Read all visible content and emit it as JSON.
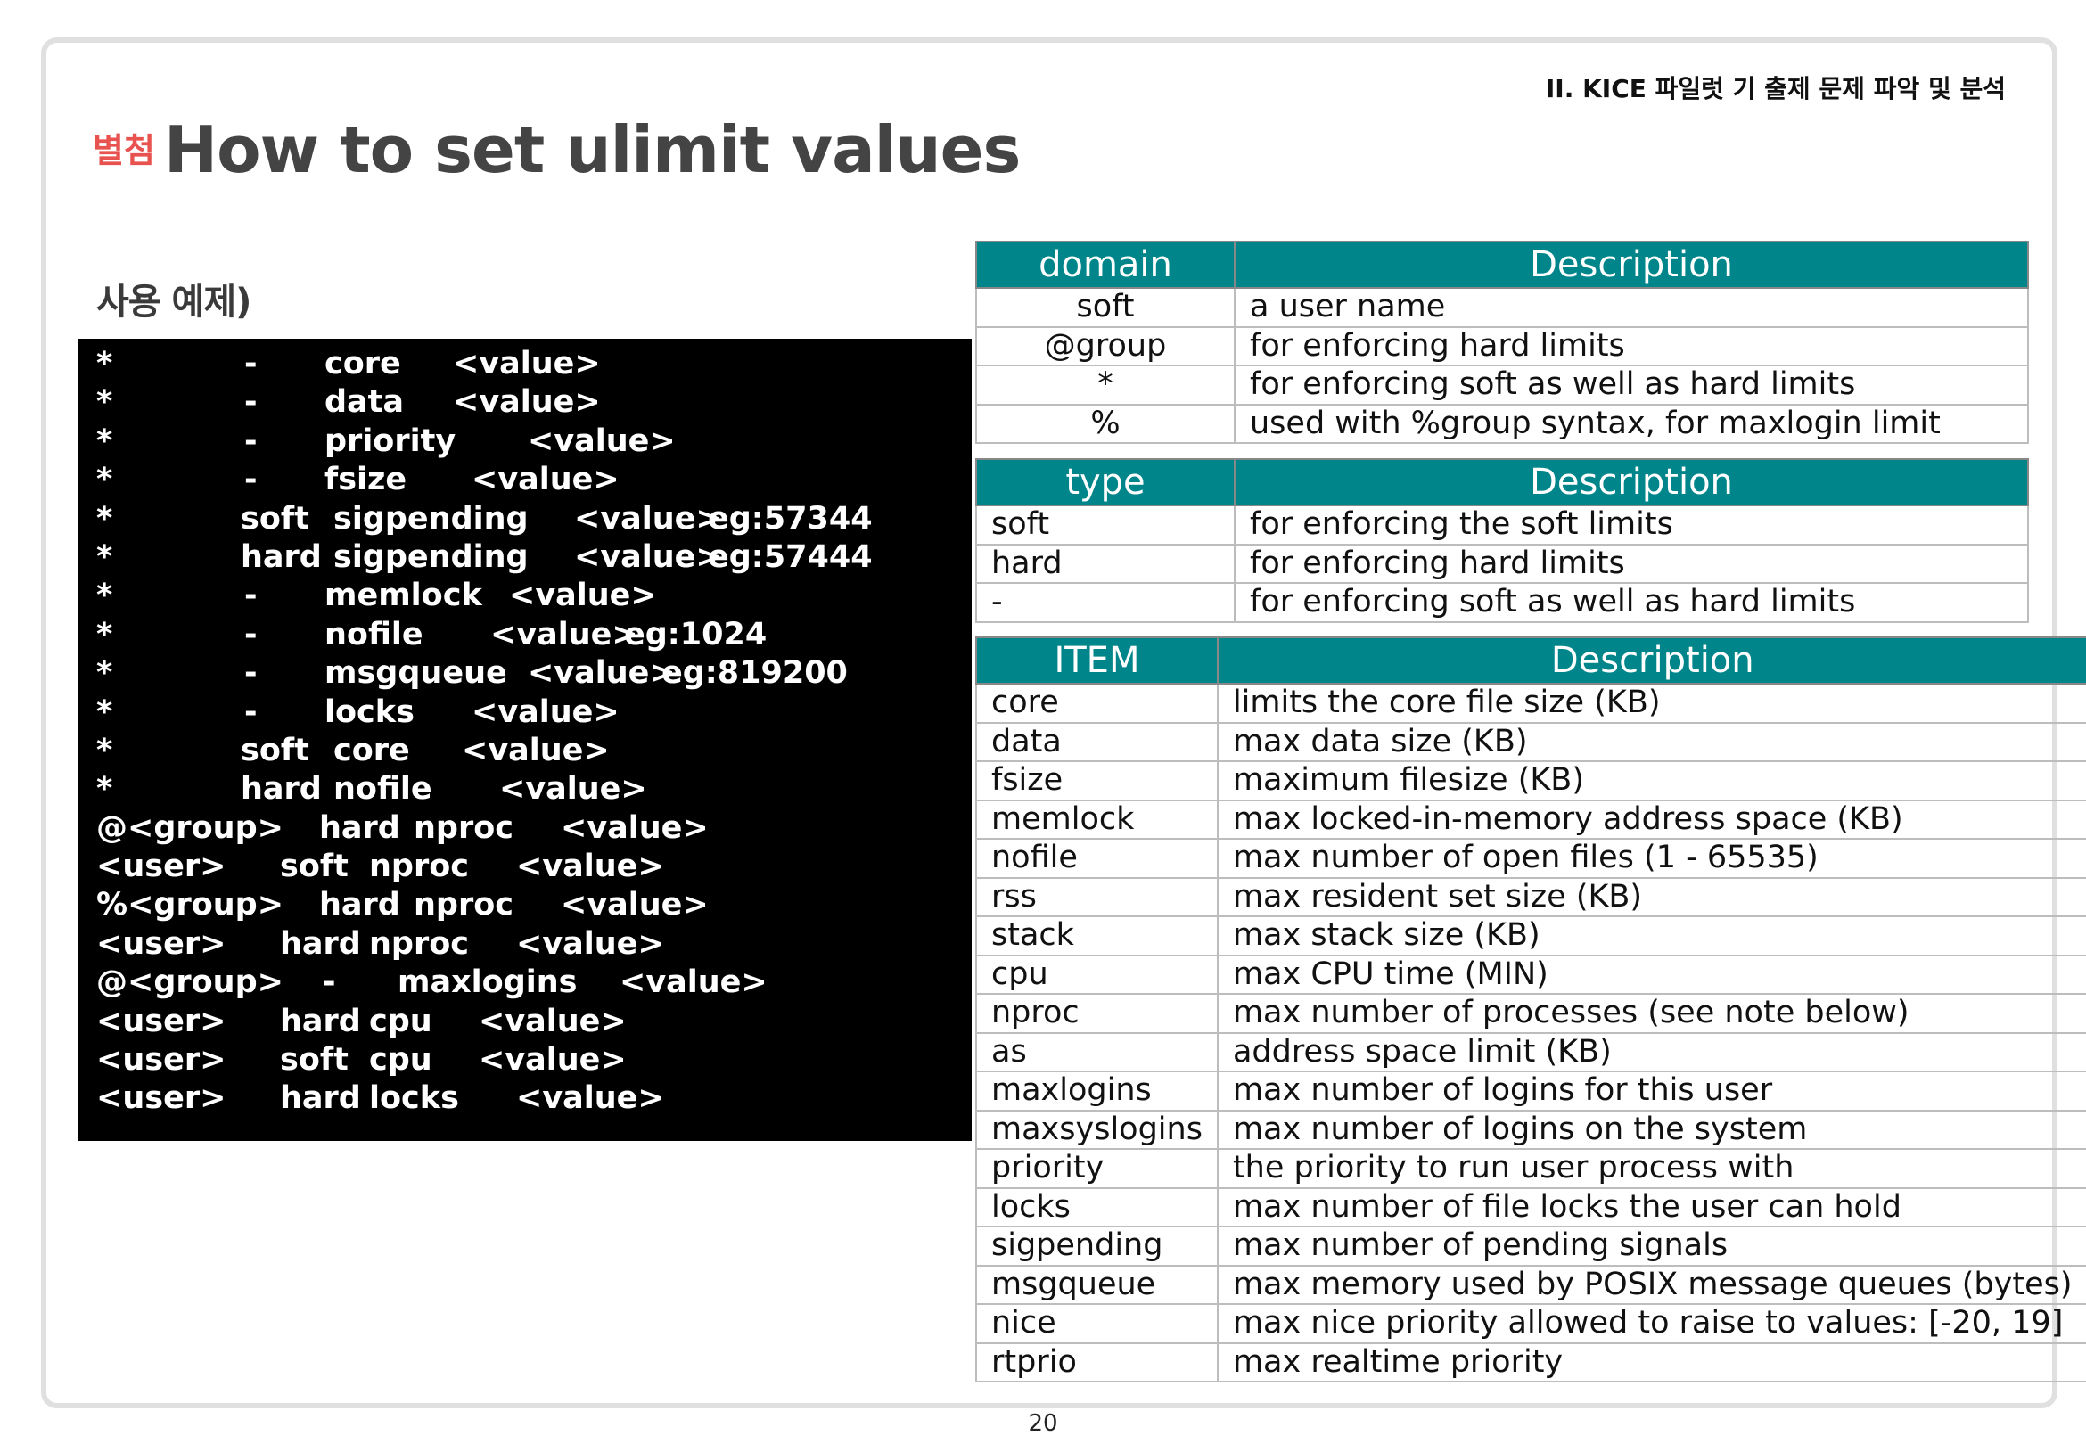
{
  "header": {
    "section": "II. KICE 파일럿 기 출제 문제 파악 및 분석",
    "appendix_label": "별첨",
    "title": "How to set ulimit values"
  },
  "example": {
    "subtitle": "사용 예제)",
    "lines": [
      [
        "*",
        "-",
        "core",
        "<value>",
        ""
      ],
      [
        "*",
        "-",
        "data",
        "<value>",
        ""
      ],
      [
        "*",
        "-",
        "priority",
        "<value>",
        ""
      ],
      [
        "*",
        "-",
        "fsize",
        "<value>",
        ""
      ],
      [
        "*",
        "soft",
        "sigpending",
        "<value>",
        "eg:57344"
      ],
      [
        "*",
        "hard",
        "sigpending",
        "<value>",
        "eg:57444"
      ],
      [
        "*",
        "-",
        "memlock",
        "<value>",
        ""
      ],
      [
        "*",
        "-",
        "nofile",
        "<value>",
        "eg:1024"
      ],
      [
        "*",
        "-",
        "msgqueue",
        "<value>",
        "eg:819200"
      ],
      [
        "*",
        "-",
        "locks",
        "<value>",
        ""
      ],
      [
        "*",
        "soft",
        "core",
        "<value>",
        ""
      ],
      [
        "*",
        "hard",
        "nofile",
        "<value>",
        ""
      ],
      [
        "@<group>",
        "hard",
        "nproc",
        "<value>",
        ""
      ],
      [
        "<user>",
        "soft",
        "nproc",
        "<value>",
        ""
      ],
      [
        "%<group>",
        "hard",
        "nproc",
        "<value>",
        ""
      ],
      [
        "<user>",
        "hard",
        "nproc",
        "<value>",
        ""
      ],
      [
        "@<group>",
        "-",
        "maxlogins",
        "<value>",
        ""
      ],
      [
        "<user>",
        "hard",
        "cpu",
        "<value>",
        ""
      ],
      [
        "<user>",
        "soft",
        "cpu",
        "<value>",
        ""
      ],
      [
        "<user>",
        "hard",
        "locks",
        "<value>",
        ""
      ]
    ]
  },
  "domain_table": {
    "headers": [
      "domain",
      "Description"
    ],
    "rows": [
      [
        "soft",
        "a user name"
      ],
      [
        "@group",
        "for enforcing hard limits"
      ],
      [
        "*",
        "for enforcing soft as well as hard limits"
      ],
      [
        "%",
        "used with %group syntax, for maxlogin limit"
      ]
    ]
  },
  "type_table": {
    "headers": [
      "type",
      "Description"
    ],
    "rows": [
      [
        "soft",
        "for enforcing the soft limits"
      ],
      [
        "hard",
        "for enforcing hard limits"
      ],
      [
        "-",
        "for enforcing soft as well as hard limits"
      ]
    ]
  },
  "item_table": {
    "headers": [
      "ITEM",
      "Description"
    ],
    "rows": [
      [
        "core",
        "limits the core file size (KB)"
      ],
      [
        "data",
        "max data size (KB)"
      ],
      [
        "fsize",
        "maximum filesize (KB)"
      ],
      [
        "memlock",
        "max locked-in-memory address space (KB)"
      ],
      [
        "nofile",
        "max number of open files (1 - 65535)"
      ],
      [
        "rss",
        "max resident set size (KB)"
      ],
      [
        "stack",
        "max stack size (KB)"
      ],
      [
        "cpu",
        "max CPU time (MIN)"
      ],
      [
        "nproc",
        "max number of processes (see note below)"
      ],
      [
        "as",
        "address space limit (KB)"
      ],
      [
        "maxlogins",
        "max number of logins for this user"
      ],
      [
        "maxsyslogins",
        "max number of logins on the system"
      ],
      [
        "priority",
        "the priority to run user process with"
      ],
      [
        "locks",
        "max number of file locks the user can hold"
      ],
      [
        "sigpending",
        "max number of pending signals"
      ],
      [
        "msgqueue",
        "max memory used by POSIX message queues (bytes)"
      ],
      [
        "nice",
        "max nice priority allowed to raise to values: [-20, 19]"
      ],
      [
        "rtprio",
        "max realtime priority"
      ]
    ]
  },
  "footer": {
    "page_number": "20"
  }
}
